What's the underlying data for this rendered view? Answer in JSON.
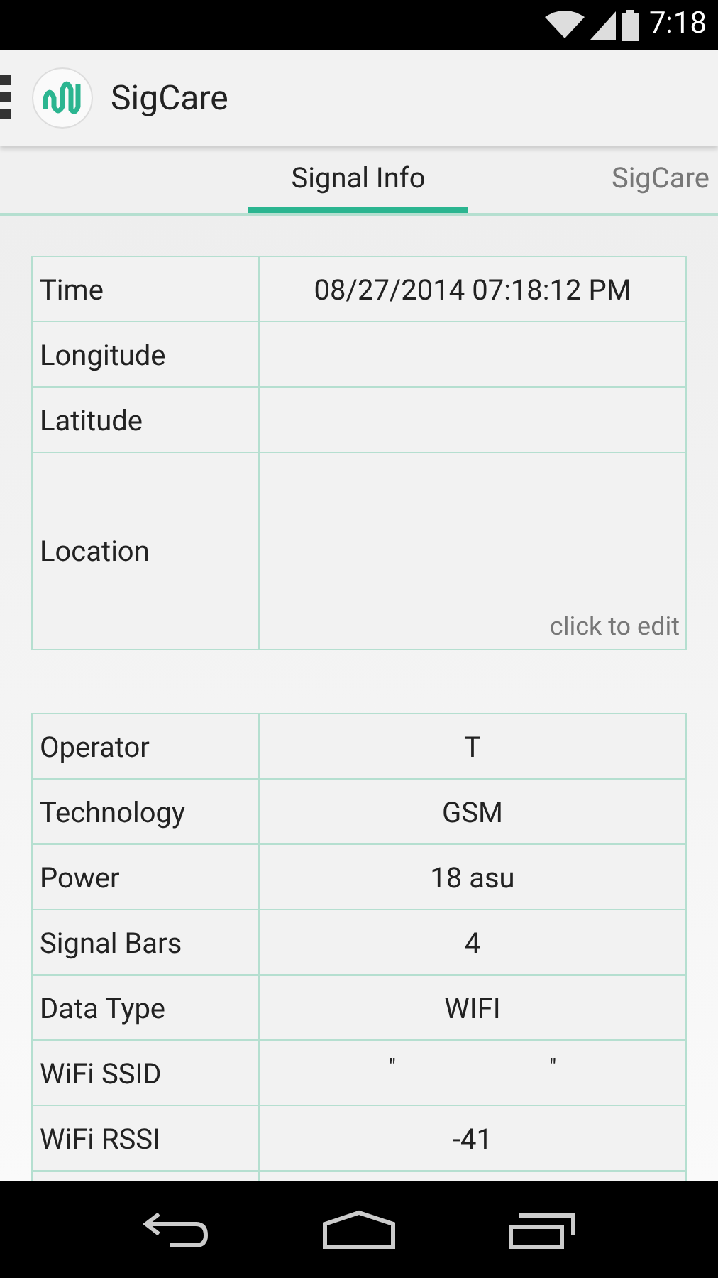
{
  "status_bar": {
    "time": "7:18"
  },
  "app_bar": {
    "title": "SigCare"
  },
  "tabs": [
    {
      "label": "Signal Info",
      "selected": true
    },
    {
      "label": "SigCare",
      "selected": false
    }
  ],
  "location_table": {
    "rows": [
      {
        "label": "Time",
        "value": "08/27/2014 07:18:12 PM"
      },
      {
        "label": "Longitude"
      },
      {
        "label": "Latitude"
      },
      {
        "label": "Location",
        "kind": "editable",
        "hint": "click to edit"
      }
    ]
  },
  "signal_table": {
    "rows": [
      {
        "label": "Operator",
        "value": "T"
      },
      {
        "label": "Technology",
        "value": "GSM"
      },
      {
        "label": "Power",
        "value": "18 asu"
      },
      {
        "label": "Signal Bars",
        "value": "4"
      },
      {
        "label": "Data Type",
        "value": "WIFI"
      },
      {
        "label": "WiFi SSID",
        "value_parts": [
          "\"",
          "\""
        ]
      },
      {
        "label": "WiFi RSSI",
        "value": "-41"
      }
    ]
  }
}
